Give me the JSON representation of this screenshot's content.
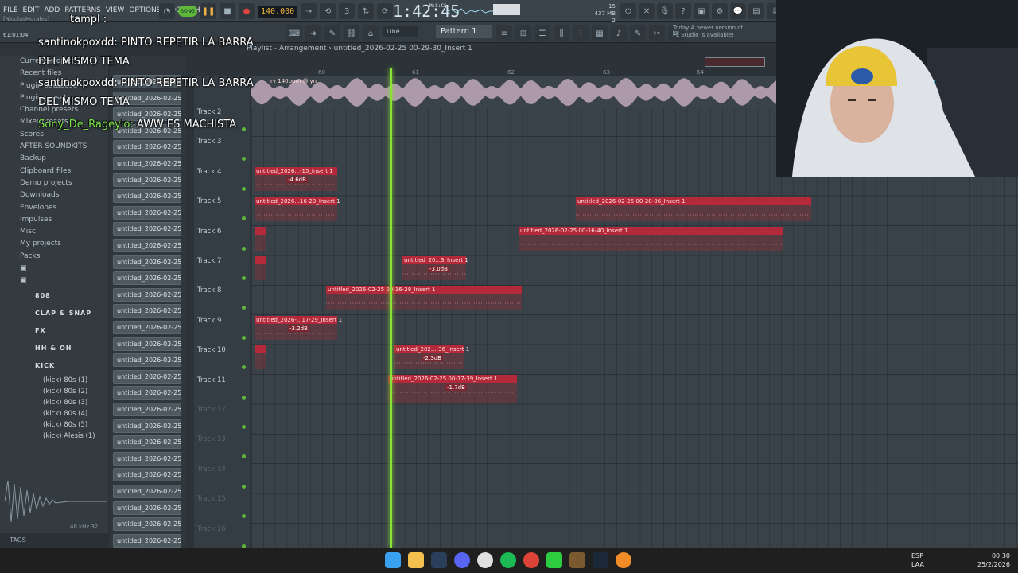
{
  "menu": [
    "FILE",
    "EDIT",
    "ADD",
    "PATTERNS",
    "VIEW",
    "OPTIONS",
    "TOOLS",
    "HELP"
  ],
  "transport": {
    "mode": "SONG",
    "tempo": "140.000",
    "time": "1:42:45",
    "time_unit": "M:S:CS"
  },
  "cpu": {
    "cpu": "15",
    "mem": "437 MB",
    "voices": "2"
  },
  "user": {
    "name": "[NicolasMorales]",
    "time": "61:01:04"
  },
  "toolbar": {
    "snap": "Line",
    "pattern": "Pattern 1"
  },
  "news": {
    "line1": "Today  A newer version of",
    "line2": "FL Studio is available!"
  },
  "playlist": {
    "title": "Playlist - Arrangement › untitled_2026-02-25 00-29-30_Insert 1"
  },
  "ruler": [
    "60",
    "61",
    "62",
    "63",
    "64"
  ],
  "master_track_label": "ry 140bpm @lyn",
  "browser": {
    "items": [
      "Current project",
      "Recent files",
      "Plugin database",
      "Plugin presets",
      "Channel presets",
      "Mixer presets",
      "Scores",
      "AFTER SOUNDKITS",
      "Backup",
      "Clipboard files",
      "Demo projects",
      "Downloads",
      "Envelopes",
      "Impulses",
      "Misc",
      "My projects",
      "Packs"
    ],
    "subfolders": [
      "808",
      "CLAP & SNAP",
      "FX",
      "HH & OH",
      "KICK"
    ],
    "kicks": [
      "(kick) 80s (1)",
      "(kick) 80s (2)",
      "(kick) 80s (3)",
      "(kick) 80s (4)",
      "(kick) 80s (5)",
      "(kick) Alesis (1)"
    ],
    "tags": "TAGS",
    "sample_rate": "48 kHz 32"
  },
  "channels": [
    "untitled_2026-02-25 00-",
    "untitled_2026-02-25 00-",
    "untitled_2026-02-25 00-",
    "untitled_2026-02-25 00-",
    "untitled_2026-02-25 00-",
    "untitled_2026-02-25 00-",
    "untitled_2026-02-25 00-",
    "untitled_2026-02-25 00-",
    "untitled_2026-02-25 00-",
    "untitled_2026-02-25 00-",
    "untitled_2026-02-25 00-",
    "untitled_2026-02-25 00-",
    "untitled_2026-02-25 00-",
    "untitled_2026-02-25 00-",
    "untitled_2026-02-25 00-",
    "untitled_2026-02-25 00-",
    "untitled_2026-02-25 00-",
    "untitled_2026-02-25 00-",
    "untitled_2026-02-25 00-",
    "untitled_2026-02-25 00-",
    "untitled_2026-02-25 00-",
    "untitled_2026-02-25 00-",
    "untitled_2026-02-25 00-",
    "untitled_2026-02-25 00-",
    "untitled_2026-02-25 00-",
    "untitled_2026-02-25 00-",
    "untitled_2026-02-25 00-",
    "untitled_2026-02-25 00-",
    "untitled_2026-02-25 00-",
    "untitled_2026-02-25 00-"
  ],
  "tracks": [
    "Track 2",
    "Track 3",
    "Track 4",
    "Track 5",
    "Track 6",
    "Track 7",
    "Track 8",
    "Track 9",
    "Track 10",
    "Track 11",
    "Track 12",
    "Track 13",
    "Track 14",
    "Track 15",
    "Track 16"
  ],
  "clips": [
    {
      "title": "untitled_2026...-15_Insert 1",
      "gain": "-4.6dB"
    },
    {
      "title": "untitled_2026...16-20_Insert 1",
      "gain": ""
    },
    {
      "title": "untitled_2026-02-25 00-28-06_Insert 1",
      "gain": ""
    },
    {
      "title": "untitled_2026-02-25 00-16-40_Insert 1",
      "gain": ""
    },
    {
      "title": "untitled_20...3_Insert 1",
      "gain": "-3.0dB"
    },
    {
      "title": "untitled_2026-02-25 00-16-28_Insert 1",
      "gain": ""
    },
    {
      "title": "untitled_2026-...17-29_Insert 1",
      "gain": "-3.2dB"
    },
    {
      "title": "untitled_202...-36_Insert 1",
      "gain": "-2.3dB"
    },
    {
      "title": "untitled_2026-02-25 00-17-39_Insert 1",
      "gain": "-1.7dB"
    }
  ],
  "chat": [
    {
      "user": "santinokpoxdd:",
      "text": "PINTO REPETIR LA BARRA"
    },
    {
      "user": "",
      "text": "DEL MISMO TEMA"
    },
    {
      "user": "santinokpoxdd:",
      "text": "PINTO REPETIR LA BARRA"
    },
    {
      "user": "",
      "text": "DEL MISMO TEMA"
    },
    {
      "user": "Sony_De_Rageylo:",
      "text": "AWW ES MACHISTA"
    }
  ],
  "chat_partial": "tampl :",
  "taskbar": {
    "lang1": "ESP",
    "lang2": "LAA",
    "clock": "00:30",
    "date": "25/2/2026"
  }
}
